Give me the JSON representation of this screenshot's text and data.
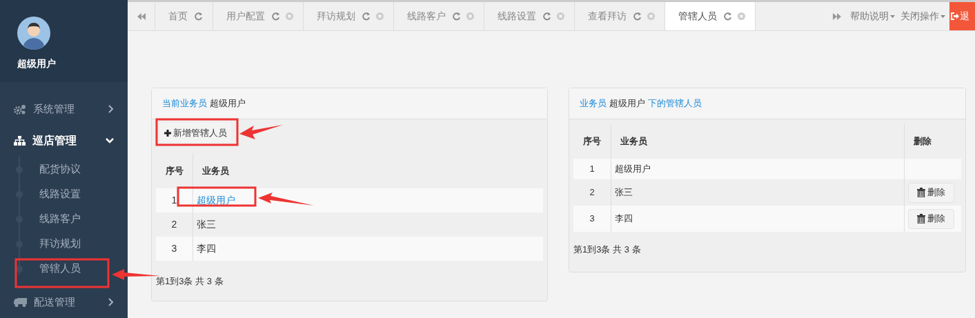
{
  "sidebar": {
    "user_name": "超级用户",
    "menu": [
      {
        "label": "系统管理",
        "kind": "gears",
        "expanded": false
      },
      {
        "label": "巡店管理",
        "kind": "sitemap",
        "expanded": true,
        "children": [
          {
            "label": "配货协议"
          },
          {
            "label": "线路设置"
          },
          {
            "label": "线路客户"
          },
          {
            "label": "拜访规划"
          },
          {
            "label": "管辖人员"
          }
        ]
      },
      {
        "label": "配送管理",
        "kind": "truck",
        "expanded": false
      }
    ]
  },
  "tabs": [
    {
      "label": "首页",
      "selected": false,
      "closable": false
    },
    {
      "label": "用户配置",
      "selected": false,
      "closable": true
    },
    {
      "label": "拜访规划",
      "selected": false,
      "closable": true
    },
    {
      "label": "线路客户",
      "selected": false,
      "closable": true
    },
    {
      "label": "线路设置",
      "selected": false,
      "closable": true
    },
    {
      "label": "查看拜访",
      "selected": false,
      "closable": true
    },
    {
      "label": "管辖人员",
      "selected": true,
      "closable": true
    }
  ],
  "toolbar": {
    "help": "帮助说明",
    "close_ops": "关闭操作",
    "logout": "退"
  },
  "left_panel": {
    "title": [
      {
        "text": "当前业务员",
        "kind": "label"
      },
      {
        "text": "超级用户",
        "kind": "value"
      }
    ],
    "add_button": "新增管辖人员",
    "columns": [
      "序号",
      "业务员"
    ],
    "rows": [
      {
        "index": "1",
        "name": "超级用户",
        "link": true
      },
      {
        "index": "2",
        "name": "张三",
        "link": false
      },
      {
        "index": "3",
        "name": "李四",
        "link": false
      }
    ],
    "footer": "第1到3条 共 3 条"
  },
  "right_panel": {
    "title": [
      {
        "text": "业务员",
        "kind": "label"
      },
      {
        "text": "超级用户",
        "kind": "value"
      },
      {
        "text": "下的管辖人员",
        "kind": "label"
      }
    ],
    "columns": [
      "序号",
      "业务员",
      "删除"
    ],
    "rows": [
      {
        "index": "1",
        "name": "超级用户"
      },
      {
        "index": "2",
        "name": "张三",
        "delete_button": "删除"
      },
      {
        "index": "3",
        "name": "李四",
        "delete_button": "删除"
      }
    ],
    "footer": "第1到3条 共 3 条"
  }
}
